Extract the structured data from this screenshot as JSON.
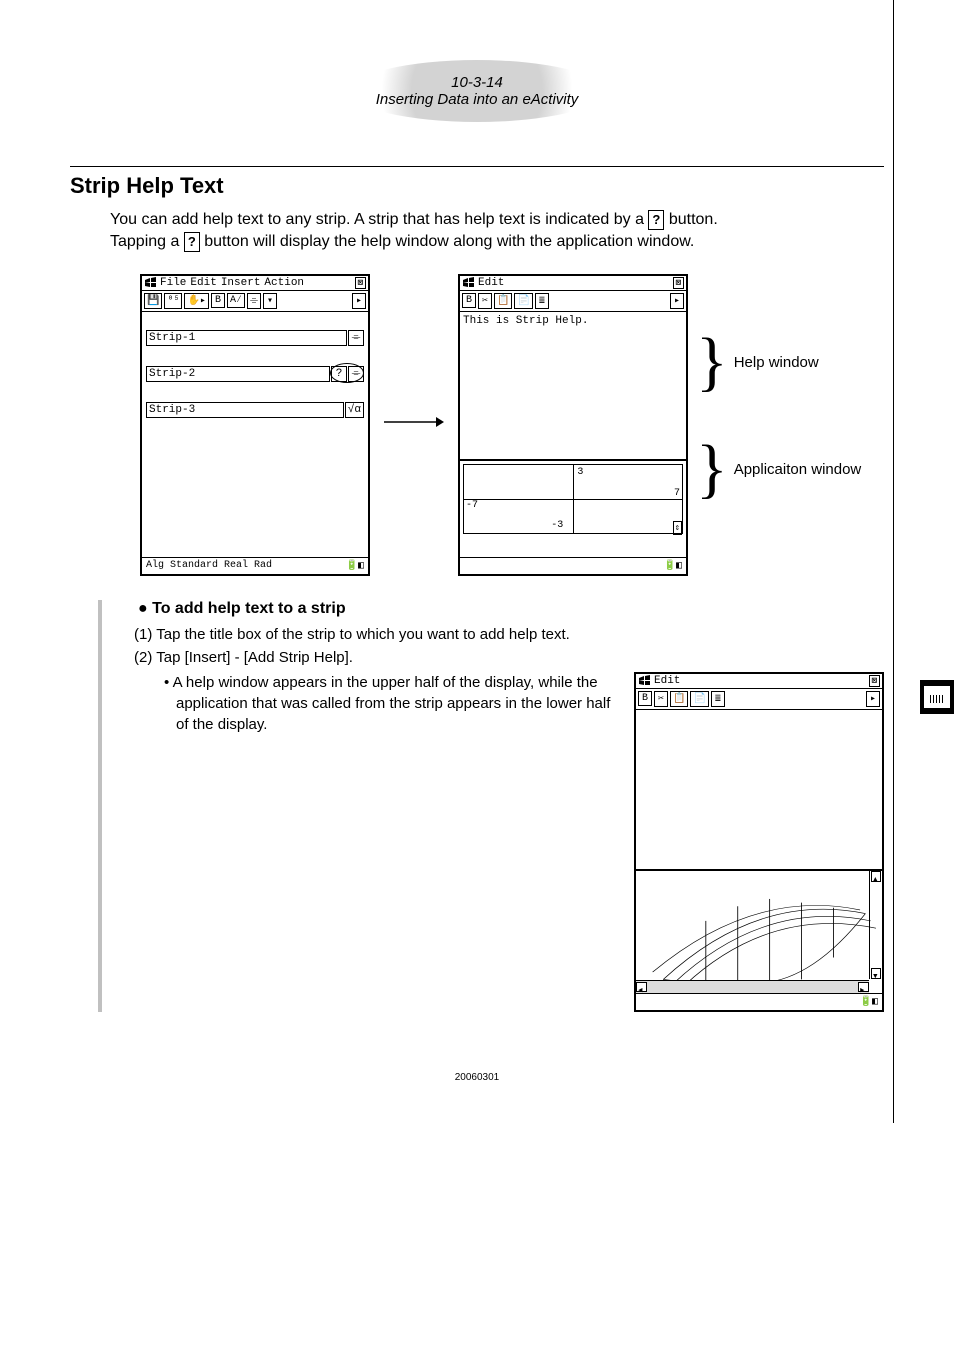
{
  "header": {
    "pagenum": "10-3-14",
    "subtitle": "Inserting Data into an eActivity"
  },
  "section": {
    "title": "Strip Help Text"
  },
  "intro": {
    "line1a": "You can add help text to any strip. A strip that has help text is indicated by a ",
    "line1b": " button.",
    "line2a": "Tapping a ",
    "line2b": " button will display the help window along with the application window.",
    "help_glyph": "?"
  },
  "screen_a": {
    "menus": [
      "File",
      "Edit",
      "Insert",
      "Action"
    ],
    "strips": [
      "Strip-1",
      "Strip-2",
      "Strip-3"
    ],
    "status": "Alg  Standard Real Rad",
    "close_glyph": "⊠"
  },
  "screen_b": {
    "menus": [
      "Edit"
    ],
    "help_content": "This is Strip Help.",
    "ticks": {
      "top": "3",
      "right": "7",
      "left": "-7",
      "bottom": "-3"
    }
  },
  "labels": {
    "help": "Help window",
    "app": "Applicaiton window"
  },
  "procedure": {
    "heading": "To add help text to a strip",
    "step1": "(1) Tap the title box of the strip to which you want to add help text.",
    "step2": "(2) Tap [Insert] - [Add Strip Help].",
    "bullet": "• A help window appears in the upper half of the display, while the application that was called from the strip appears in the lower half of the display."
  },
  "screen_c": {
    "menus": [
      "Edit"
    ]
  },
  "footer": {
    "code": "20060301"
  },
  "toolbar_b": "B"
}
